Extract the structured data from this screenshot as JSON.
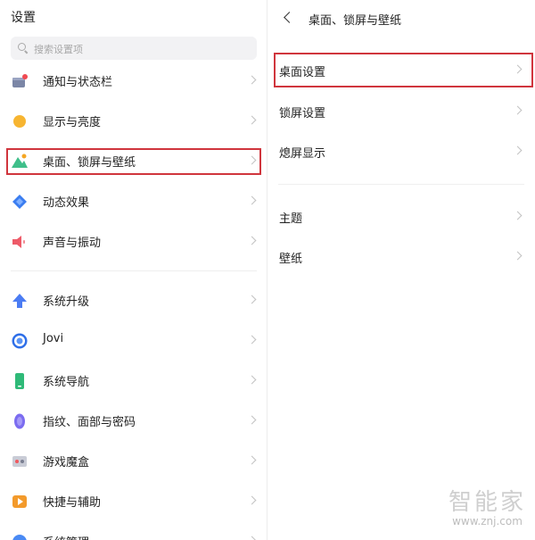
{
  "left": {
    "title": "设置",
    "search_placeholder": "搜索设置项",
    "items": [
      {
        "label": "通知与状态栏",
        "icon": "notification-icon"
      },
      {
        "label": "显示与亮度",
        "icon": "brightness-icon"
      },
      {
        "label": "桌面、锁屏与壁纸",
        "icon": "wallpaper-icon"
      },
      {
        "label": "动态效果",
        "icon": "dynamic-effects-icon"
      },
      {
        "label": "声音与振动",
        "icon": "sound-icon"
      },
      {
        "label": "系统升级",
        "icon": "system-update-icon"
      },
      {
        "label": "Jovi",
        "icon": "jovi-icon"
      },
      {
        "label": "系统导航",
        "icon": "navigation-icon"
      },
      {
        "label": "指纹、面部与密码",
        "icon": "fingerprint-icon"
      },
      {
        "label": "游戏魔盒",
        "icon": "game-box-icon"
      },
      {
        "label": "快捷与辅助",
        "icon": "shortcut-icon"
      },
      {
        "label": "系统管理",
        "icon": "system-management-icon"
      }
    ]
  },
  "right": {
    "title": "桌面、锁屏与壁纸",
    "items": [
      {
        "label": "桌面设置"
      },
      {
        "label": "锁屏设置"
      },
      {
        "label": "熄屏显示"
      },
      {
        "label": "主题"
      },
      {
        "label": "壁纸"
      }
    ]
  },
  "watermark": {
    "text": "智能家",
    "url": "www.znj.com"
  },
  "colors": {
    "highlight": "#d0353d",
    "chevron": "#c2c2c2"
  }
}
